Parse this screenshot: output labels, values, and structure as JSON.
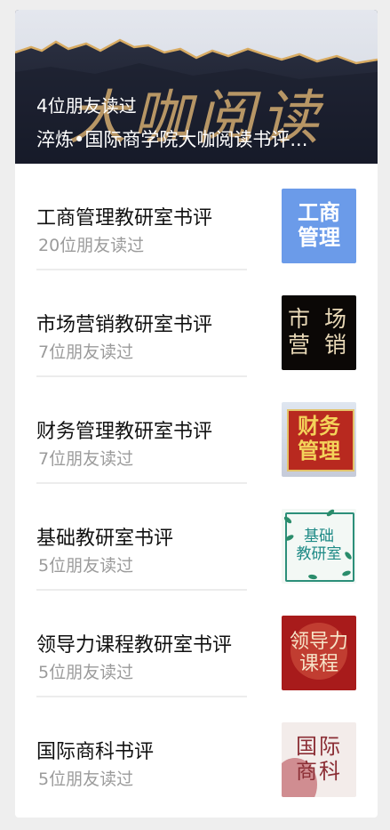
{
  "banner": {
    "art_text": "大咖阅读",
    "readers": "4位朋友读过",
    "title": "淬炼•国际商学院大咖阅读书评..."
  },
  "items": [
    {
      "title": "工商管理教研室书评",
      "readers": "20位朋友读过",
      "thumb_text": [
        "工商",
        "管理"
      ]
    },
    {
      "title": "市场营销教研室书评",
      "readers": "7位朋友读过",
      "thumb_text": [
        "市 场",
        "营 销"
      ]
    },
    {
      "title": "财务管理教研室书评",
      "readers": "7位朋友读过",
      "thumb_text": [
        "财务",
        "管理"
      ]
    },
    {
      "title": "基础教研室书评",
      "readers": "5位朋友读过",
      "thumb_text": [
        "基础",
        "教研室"
      ]
    },
    {
      "title": "领导力课程教研室书评",
      "readers": "5位朋友读过",
      "thumb_text": [
        "领导力",
        "课程"
      ]
    },
    {
      "title": "国际商科书评",
      "readers": "5位朋友读过",
      "thumb_text": [
        "国际",
        "商科"
      ]
    }
  ],
  "colors": {
    "background": "#eeeeee",
    "card": "#ffffff",
    "title_text": "#111111",
    "sub_text": "#9b9b9b"
  }
}
